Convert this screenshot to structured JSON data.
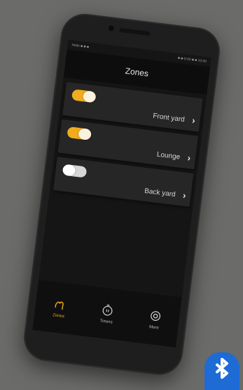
{
  "app": {
    "title": "Zones"
  },
  "status": {
    "left": "Hello ■ ■ ■",
    "right": "■ ■ 5:00 ■ ■ 10:00"
  },
  "zones": [
    {
      "label": "Front yard",
      "on": true
    },
    {
      "label": "Lounge",
      "on": true
    },
    {
      "label": "Back yard",
      "on": false
    }
  ],
  "nav": {
    "items": [
      {
        "label": "Zones",
        "icon": "zones-icon",
        "active": true
      },
      {
        "label": "Timers",
        "icon": "timer-icon",
        "active": false
      },
      {
        "label": "More",
        "icon": "gear-icon",
        "active": false
      }
    ]
  },
  "colors": {
    "accent": "#f0ac1e",
    "background": "#151515",
    "bluetooth": "#1e6bd6"
  },
  "badge": {
    "icon": "bluetooth-icon"
  }
}
